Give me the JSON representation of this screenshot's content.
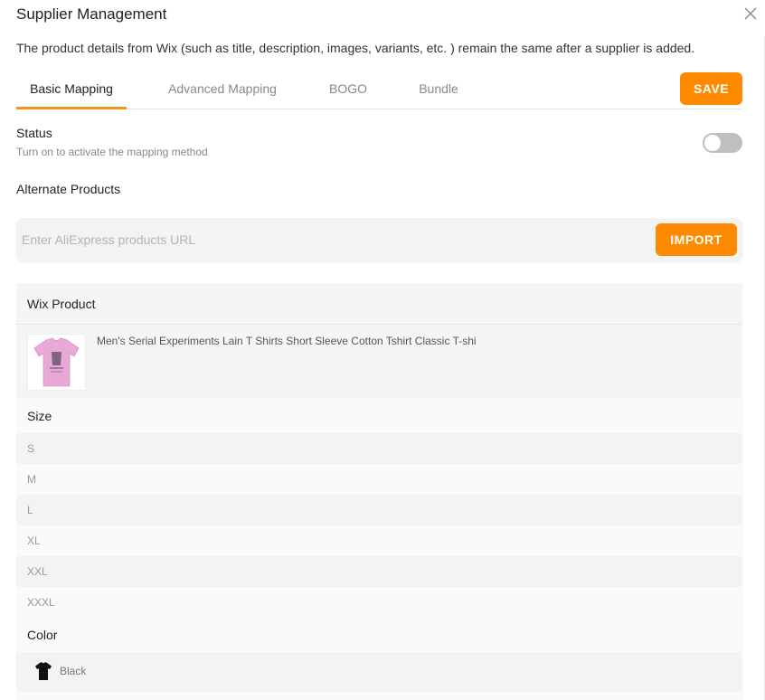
{
  "modal": {
    "title": "Supplier Management",
    "close_icon": "close-icon",
    "subtitle": "The product details from Wix (such as title, description, images, variants, etc. ) remain the same after a supplier is added."
  },
  "tabs": [
    {
      "label": "Basic Mapping",
      "active": true
    },
    {
      "label": "Advanced Mapping",
      "active": false
    },
    {
      "label": "BOGO",
      "active": false
    },
    {
      "label": "Bundle",
      "active": false
    }
  ],
  "toolbar": {
    "save_label": "SAVE"
  },
  "status": {
    "title": "Status",
    "description": "Turn on to activate the mapping method",
    "enabled": false
  },
  "alternate": {
    "title": "Alternate Products",
    "url_placeholder": "Enter AliExpress products URL",
    "url_value": "",
    "import_label": "IMPORT"
  },
  "product_table": {
    "header": "Wix Product",
    "product_name": "Men's Serial Experiments Lain T Shirts Short Sleeve Cotton Tshirt Classic T-shi",
    "thumbnail_icon": "tshirt-pink-icon",
    "size_header": "Size",
    "sizes": [
      "S",
      "M",
      "L",
      "XL",
      "XXL",
      "XXXL"
    ],
    "color_header": "Color",
    "colors": [
      {
        "label": "Black",
        "icon": "tshirt-black-icon"
      }
    ]
  },
  "colors": {
    "accent": "#ff8a00",
    "tab_underline": "#f7941d",
    "toggle_off": "#bfbfbf",
    "product_tshirt": "#e8a9d6"
  }
}
